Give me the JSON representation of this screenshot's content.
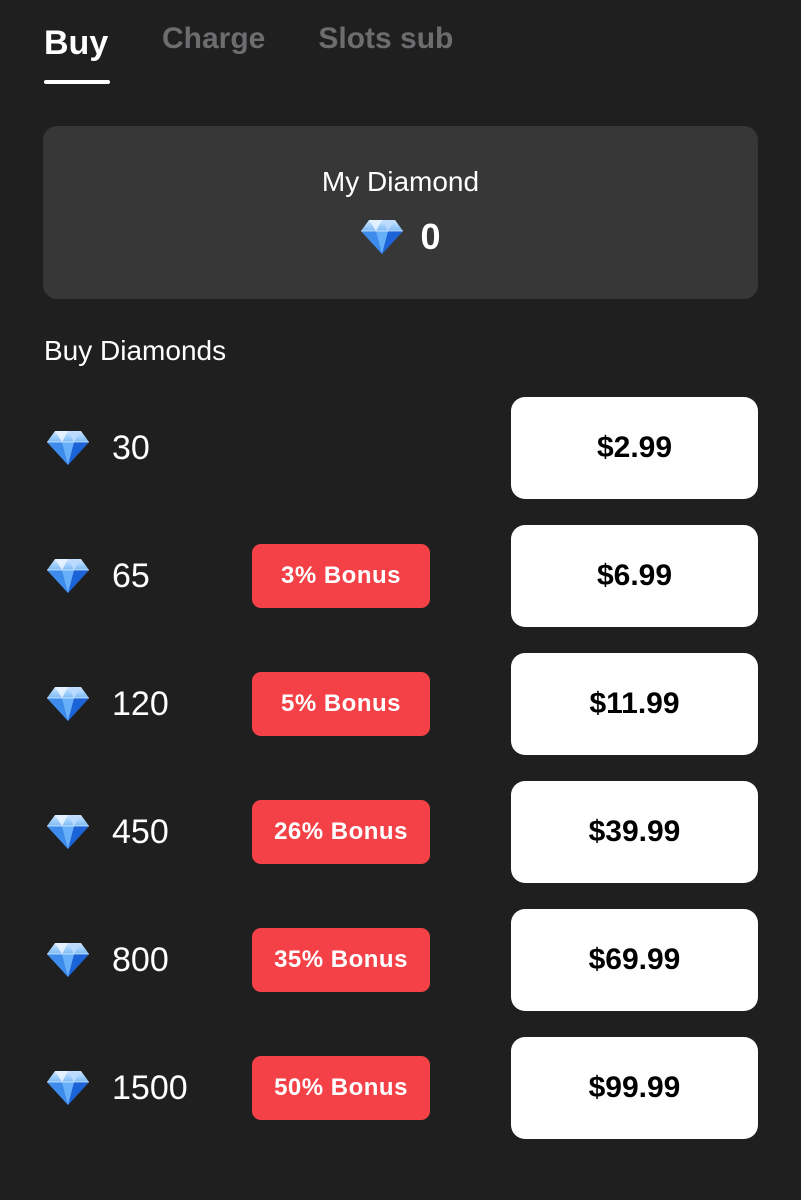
{
  "tabs": [
    {
      "label": "Buy",
      "active": true
    },
    {
      "label": "Charge",
      "active": false
    },
    {
      "label": "Slots sub",
      "active": false
    }
  ],
  "balance": {
    "title": "My Diamond",
    "icon": "diamond-icon",
    "value": "0"
  },
  "section_title": "Buy Diamonds",
  "packages": [
    {
      "amount": "30",
      "bonus": "",
      "price": "$2.99",
      "icon": "diamond-icon"
    },
    {
      "amount": "65",
      "bonus": "3% Bonus",
      "price": "$6.99",
      "icon": "diamond-icon"
    },
    {
      "amount": "120",
      "bonus": "5% Bonus",
      "price": "$11.99",
      "icon": "diamond-icon"
    },
    {
      "amount": "450",
      "bonus": "26% Bonus",
      "price": "$39.99",
      "icon": "diamond-icon"
    },
    {
      "amount": "800",
      "bonus": "35% Bonus",
      "price": "$69.99",
      "icon": "diamond-icon"
    },
    {
      "amount": "1500",
      "bonus": "50% Bonus",
      "price": "$99.99",
      "icon": "diamond-icon"
    }
  ],
  "colors": {
    "background": "#1f1f20",
    "card": "#373737",
    "bonus": "#f34147",
    "price_button": "#ffffff",
    "inactive_tab": "#6d6d70"
  }
}
